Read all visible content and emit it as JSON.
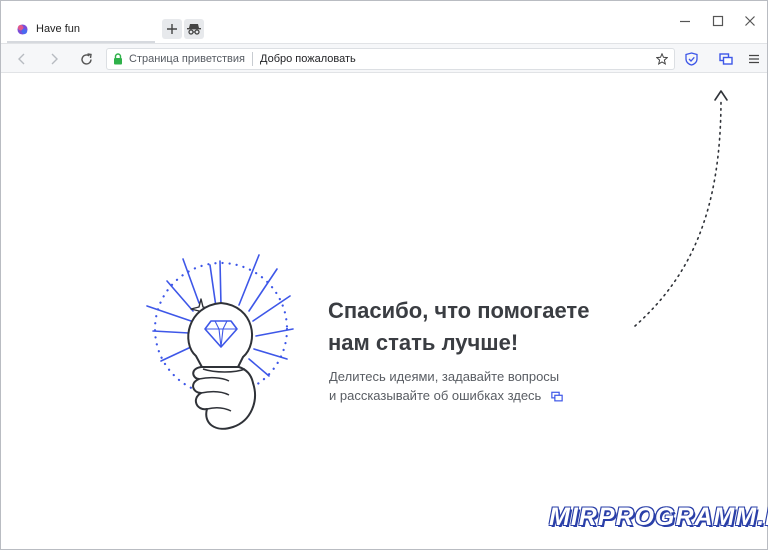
{
  "tab": {
    "title": "Have fun"
  },
  "address_bar": {
    "site_label": "Страница приветствия",
    "page_title": "Добро пожаловать"
  },
  "content": {
    "headline_line1": "Спасибо, что помогаете",
    "headline_line2": "нам стать лучше!",
    "sub_line1": "Делитесь идеями, задавайте вопросы",
    "sub_line2": "и рассказывайте об ошибках здесь"
  },
  "watermark": "MIRPROGRAMM.RU",
  "icons": {
    "tab": "yandex-browser-tab-icon",
    "new_tab": "plus-icon",
    "incognito": "incognito-icon",
    "minimize": "minimize-icon",
    "maximize": "maximize-icon",
    "close": "close-icon",
    "back": "back-arrow-icon",
    "forward": "forward-arrow-icon",
    "reload": "reload-icon",
    "lock": "lock-icon",
    "star": "star-icon",
    "protect": "shield-icon",
    "feedback": "feedback-icon",
    "menu": "hamburger-menu-icon"
  },
  "colors": {
    "accent": "#3e57e8",
    "lock": "#2fb14a",
    "heading": "#3a3d42"
  }
}
